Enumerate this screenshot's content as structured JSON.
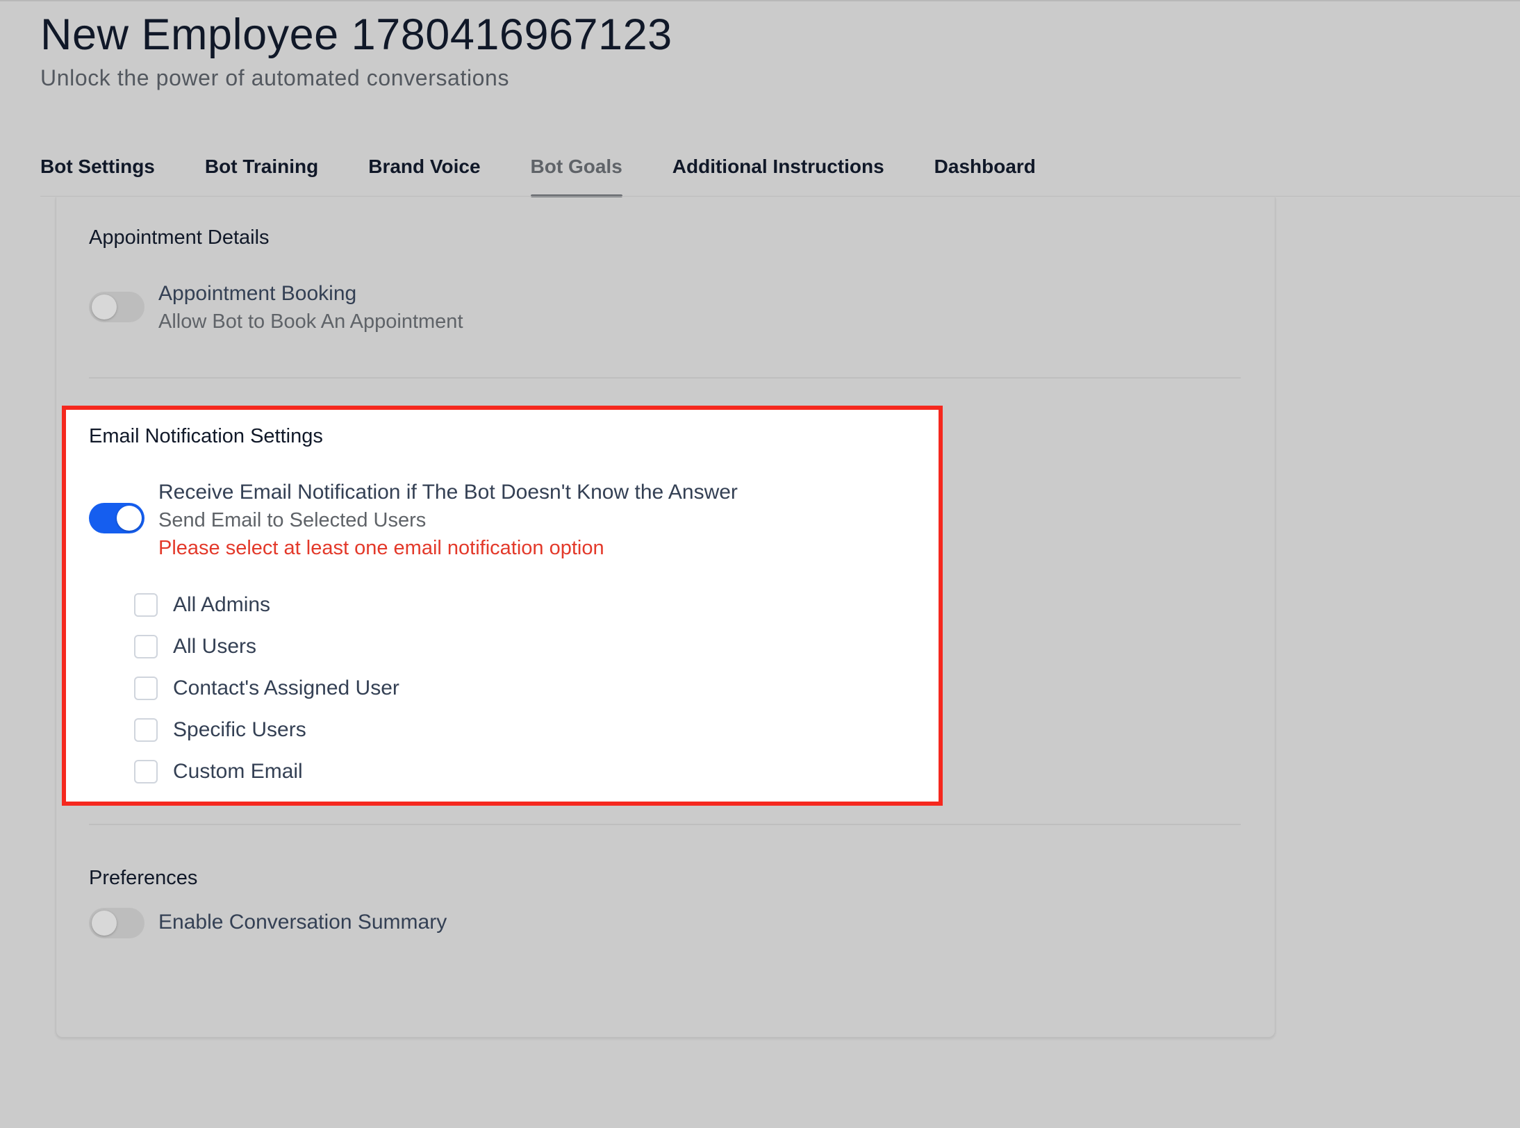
{
  "header": {
    "title": "New Employee 1780416967123",
    "subtitle": "Unlock the power of automated conversations"
  },
  "tabs": [
    {
      "label": "Bot Settings",
      "active": false
    },
    {
      "label": "Bot Training",
      "active": false
    },
    {
      "label": "Brand Voice",
      "active": false
    },
    {
      "label": "Bot Goals",
      "active": true
    },
    {
      "label": "Additional Instructions",
      "active": false
    },
    {
      "label": "Dashboard",
      "active": false
    }
  ],
  "appointment": {
    "section_title": "Appointment Details",
    "booking_title": "Appointment Booking",
    "booking_desc": "Allow Bot to Book An Appointment",
    "booking_enabled": false
  },
  "email_notifications": {
    "section_title": "Email Notification Settings",
    "toggle_title": "Receive Email Notification if The Bot Doesn't Know the Answer",
    "toggle_desc": "Send Email to Selected Users",
    "error": "Please select at least one email notification option",
    "enabled": true,
    "options": [
      {
        "label": "All Admins",
        "checked": false
      },
      {
        "label": "All Users",
        "checked": false
      },
      {
        "label": "Contact's Assigned User",
        "checked": false
      },
      {
        "label": "Specific Users",
        "checked": false
      },
      {
        "label": "Custom Email",
        "checked": false
      }
    ]
  },
  "preferences": {
    "section_title": "Preferences",
    "summary_label": "Enable Conversation Summary",
    "summary_enabled": false
  },
  "colors": {
    "toggle_on": "#155eef",
    "error": "#e3392a",
    "highlight_border": "#f5281e"
  }
}
